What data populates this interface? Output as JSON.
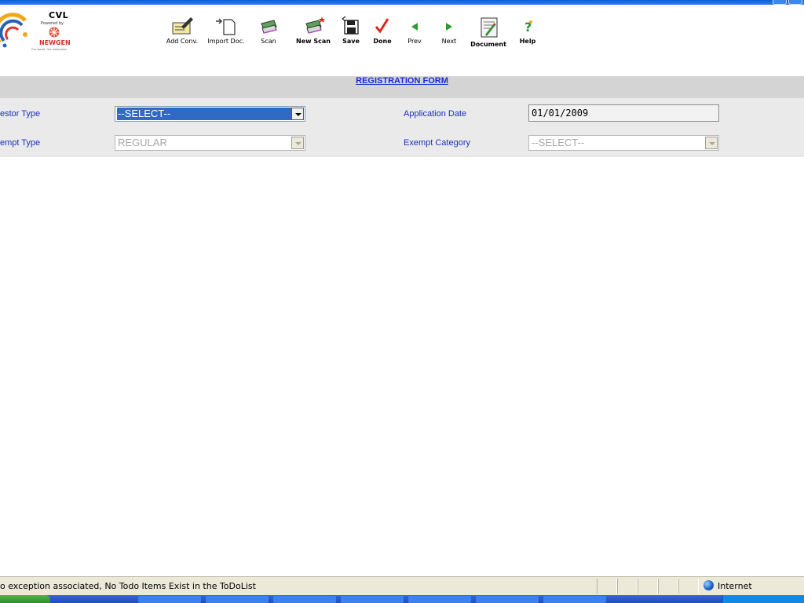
{
  "app": {
    "logo_title": "CVL",
    "logo_powered": "Powered by",
    "logo_brand": "NEWGEN",
    "logo_tagline": "Our world. Our workplace"
  },
  "toolbar": [
    {
      "id": "add-conv",
      "label": "Add Conv.",
      "icon": "add-conversation-icon",
      "bold": false
    },
    {
      "id": "import-doc",
      "label": "Import Doc.",
      "icon": "import-document-icon",
      "bold": false
    },
    {
      "id": "scan",
      "label": "Scan",
      "icon": "scanner-icon",
      "bold": false
    },
    {
      "id": "new-scan",
      "label": "New Scan",
      "icon": "new-scan-icon",
      "bold": true
    },
    {
      "id": "save",
      "label": "Save",
      "icon": "save-icon",
      "bold": true
    },
    {
      "id": "done",
      "label": "Done",
      "icon": "checkmark-icon",
      "bold": true
    },
    {
      "id": "prev",
      "label": "Prev",
      "icon": "arrow-left-icon",
      "bold": false
    },
    {
      "id": "next",
      "label": "Next",
      "icon": "arrow-right-icon",
      "bold": false
    },
    {
      "id": "document",
      "label": "Document",
      "icon": "document-icon",
      "bold": true
    },
    {
      "id": "help",
      "label": "Help",
      "icon": "help-icon",
      "bold": true
    }
  ],
  "form": {
    "title": "REGISTRATION FORM",
    "investor_type_label": "estor Type",
    "investor_type_value": "--SELECT--",
    "exempt_type_label": "empt Type",
    "exempt_type_value": "REGULAR",
    "application_date_label": "Application Date",
    "application_date_value": "01/01/2009",
    "exempt_category_label": "Exempt Category",
    "exempt_category_value": "--SELECT--"
  },
  "status": {
    "message": "o exception associated, No Todo Items Exist in the ToDoList",
    "zone": "Internet"
  },
  "colors": {
    "label_blue": "#1a32b8",
    "title_blue": "#1a2bd1",
    "selection_blue": "#316ac5",
    "band_gray": "#d4d4d4",
    "form_gray": "#eaeaea"
  }
}
